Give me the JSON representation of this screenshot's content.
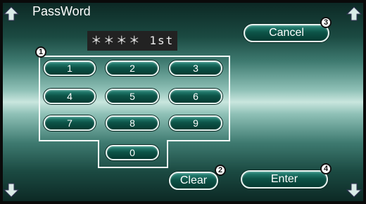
{
  "title": "PassWord",
  "password_display": "＊＊＊＊ 1st",
  "keypad": [
    "1",
    "2",
    "3",
    "4",
    "5",
    "6",
    "7",
    "8",
    "9",
    "0"
  ],
  "buttons": {
    "cancel": "Cancel",
    "clear": "Clear",
    "enter": "Enter"
  },
  "callouts": [
    "1",
    "2",
    "3",
    "4"
  ],
  "icons": {
    "corner": "diamond-arrow-icon"
  },
  "colors": {
    "button_fill": "#0d5448",
    "display_bg": "#222222"
  }
}
